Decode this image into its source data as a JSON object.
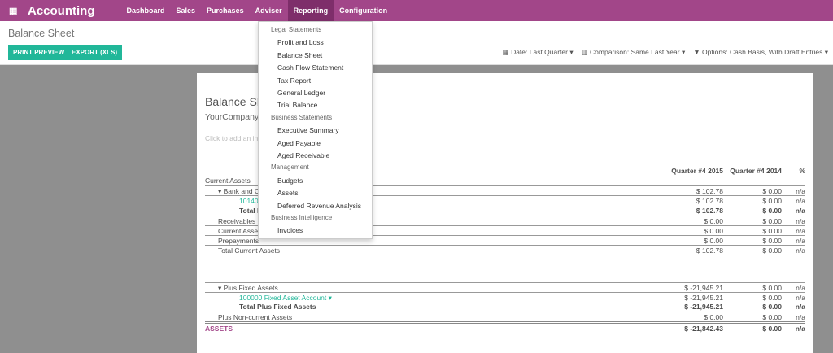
{
  "topbar": {
    "app": "Accounting",
    "menu": [
      "Dashboard",
      "Sales",
      "Purchases",
      "Adviser",
      "Reporting",
      "Configuration"
    ]
  },
  "control": {
    "title": "Balance Sheet",
    "print": "PRINT PREVIEW",
    "export": "EXPORT (XLS)",
    "date": "Date: Last Quarter",
    "comparison": "Comparison: Same Last Year",
    "options": "Options: Cash Basis, With Draft Entries"
  },
  "dropdown": [
    {
      "t": "h",
      "label": "Legal Statements"
    },
    {
      "t": "i",
      "label": "Profit and Loss"
    },
    {
      "t": "i",
      "label": "Balance Sheet"
    },
    {
      "t": "i",
      "label": "Cash Flow Statement"
    },
    {
      "t": "i",
      "label": "Tax Report"
    },
    {
      "t": "i",
      "label": "General Ledger"
    },
    {
      "t": "i",
      "label": "Trial Balance"
    },
    {
      "t": "h",
      "label": "Business Statements"
    },
    {
      "t": "i",
      "label": "Executive Summary"
    },
    {
      "t": "i",
      "label": "Aged Payable"
    },
    {
      "t": "i",
      "label": "Aged Receivable"
    },
    {
      "t": "h",
      "label": "Management"
    },
    {
      "t": "i",
      "label": "Budgets"
    },
    {
      "t": "i",
      "label": "Assets"
    },
    {
      "t": "i",
      "label": "Deferred Revenue Analysis"
    },
    {
      "t": "h",
      "label": "Business Intelligence"
    },
    {
      "t": "i",
      "label": "Invoices"
    }
  ],
  "report": {
    "title": "Balance Sheet",
    "company": "YourCompany",
    "intro_placeholder": "Click to add an introductory explanation",
    "headers": [
      "Quarter #4 2015",
      "Quarter #4 2014",
      "%"
    ],
    "rows": [
      {
        "label": "Current Assets",
        "v": [
          "",
          "",
          ""
        ],
        "indent": 0
      },
      {
        "label": "▾   Bank and Cash Accounts",
        "v": [
          "$ 102.78",
          "$ 0.00",
          "n/a"
        ],
        "indent": 1,
        "line": "bt"
      },
      {
        "label": "101401 Bank",
        "v": [
          "$ 102.78",
          "$ 0.00",
          "n/a"
        ],
        "indent": 3,
        "cls": "green",
        "line": "bt"
      },
      {
        "label": "Total Bank and Cash Accounts",
        "v": [
          "$ 102.78",
          "$ 0.00",
          "n/a"
        ],
        "indent": 4,
        "cls": "bold"
      },
      {
        "label": "Receivables",
        "v": [
          "$ 0.00",
          "$ 0.00",
          "n/a"
        ],
        "indent": 2,
        "line": "bt"
      },
      {
        "label": "Current Assets",
        "v": [
          "$ 0.00",
          "$ 0.00",
          "n/a"
        ],
        "indent": 2,
        "line": "bt"
      },
      {
        "label": "Prepayments",
        "v": [
          "$ 0.00",
          "$ 0.00",
          "n/a"
        ],
        "indent": 2,
        "line": "bt"
      },
      {
        "label": "Total Current Assets",
        "v": [
          "$ 102.78",
          "$ 0.00",
          "n/a"
        ],
        "indent": 2,
        "line": "bt"
      },
      {
        "label": "▾   Plus Fixed Assets",
        "v": [
          "$ -21,945.21",
          "$ 0.00",
          "n/a"
        ],
        "indent": 1,
        "line": "bt",
        "gap": true
      },
      {
        "label": "100000 Fixed Asset Account ▾",
        "v": [
          "$ -21,945.21",
          "$ 0.00",
          "n/a"
        ],
        "indent": 3,
        "cls": "green",
        "line": "bt"
      },
      {
        "label": "Total Plus Fixed Assets",
        "v": [
          "$ -21,945.21",
          "$ 0.00",
          "n/a"
        ],
        "indent": 4,
        "cls": "bold"
      },
      {
        "label": "Plus Non-current Assets",
        "v": [
          "$ 0.00",
          "$ 0.00",
          "n/a"
        ],
        "indent": 2,
        "line": "bt"
      },
      {
        "label": "ASSETS",
        "v": [
          "$ -21,842.43",
          "$ 0.00",
          "n/a"
        ],
        "indent": 0,
        "cls": "bold purple",
        "line": "dbl"
      }
    ]
  }
}
